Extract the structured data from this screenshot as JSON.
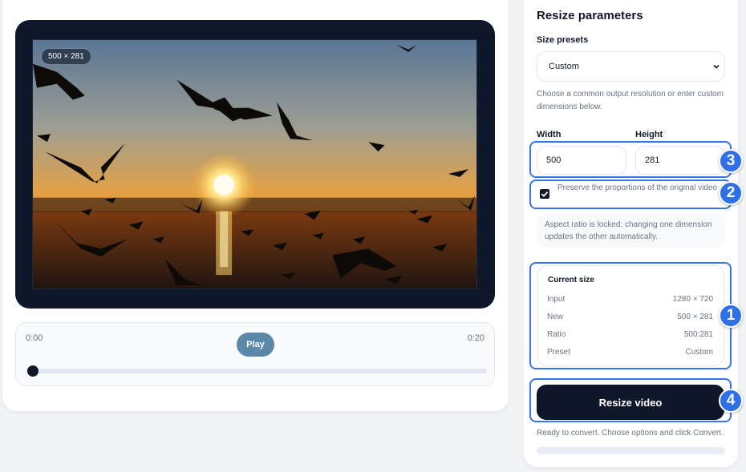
{
  "player": {
    "size_chip": "500 × 281",
    "time_start": "0:00",
    "time_end": "0:20",
    "play_label": "Play",
    "progress": 0
  },
  "panel": {
    "title": "Resize parameters",
    "presets_label": "Size presets",
    "preset_value": "Custom",
    "presets_help": "Choose a common output resolution or enter custom dimensions below.",
    "width_label": "Width",
    "height_label": "Height",
    "width_value": "500",
    "height_value": "281",
    "preserve_label": "Preserve the proportions of the original video",
    "preserve_checked": true,
    "aspect_note": "Aspect ratio is locked: changing one dimension updates the other automatically.",
    "current_size": {
      "title": "Current size",
      "rows": [
        {
          "key": "Input",
          "value": "1280 × 720"
        },
        {
          "key": "New",
          "value": "500 × 281"
        },
        {
          "key": "Ratio",
          "value": "500:281"
        },
        {
          "key": "Preset",
          "value": "Custom"
        }
      ]
    },
    "resize_button": "Resize video",
    "status": "Ready to convert. Choose options and click Convert.",
    "convert_progress": 0
  },
  "annotations": {
    "badge_1": "1",
    "badge_2": "2",
    "badge_3": "3",
    "badge_4": "4"
  },
  "colors": {
    "accent_blue": "#2f6fe8",
    "dark": "#0f172a",
    "play_button": "#5b87a8"
  }
}
